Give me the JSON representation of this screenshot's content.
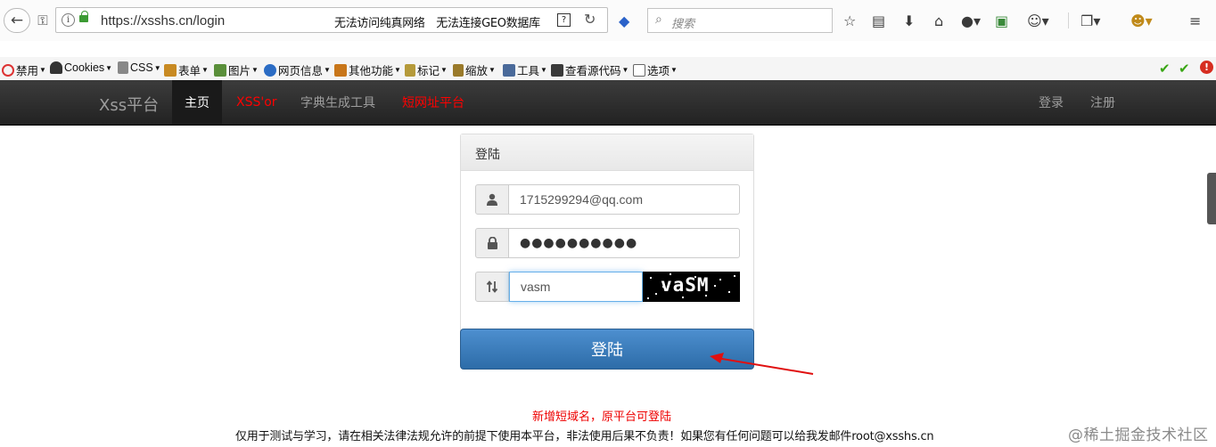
{
  "browser": {
    "url": "https://xsshs.cn/login",
    "status": "无法访问纯真网络　无法连接GEO数据库",
    "reader_glyph": "?",
    "search_placeholder": "搜索"
  },
  "devbar": {
    "items": [
      "禁用",
      "Cookies",
      "CSS",
      "表单",
      "图片",
      "网页信息",
      "其他功能",
      "标记",
      "缩放",
      "工具",
      "查看源代码",
      "选项"
    ],
    "item_colors": [
      "#d33",
      "#333",
      "#555",
      "#c88a22",
      "#5a8f3a",
      "#2b6cc4",
      "#c8761a",
      "#b59a3a",
      "#9a7a2a",
      "#4a6a9a",
      "#3a3a3a",
      "#666"
    ],
    "warning_glyph": "!"
  },
  "navbar": {
    "brand": "Xss平台",
    "items": [
      {
        "label": "主页",
        "state": "active"
      },
      {
        "label": "XSS'or",
        "state": "red"
      },
      {
        "label": "字典生成工具",
        "state": "normal"
      },
      {
        "label": "短网址平台",
        "state": "red"
      }
    ],
    "right": [
      "登录",
      "注册"
    ]
  },
  "login": {
    "heading": "登陆",
    "email_value": "1715299294@qq.com",
    "password_mask": "●●●●●●●●●●",
    "captcha_value": "vasm",
    "captcha_image_text": "vaSM",
    "submit_label": "登陆"
  },
  "footer": {
    "notice": "新增短域名，原平台可登陆",
    "text": "仅用于测试与学习，请在相关法律法规允许的前提下使用本平台，非法使用后果不负责！如果您有任何问题可以给我发邮件root@xsshs.cn"
  },
  "watermark": "@稀土掘金技术社区",
  "colors": {
    "navbar_bg": "#222222",
    "accent_red": "#ff0000",
    "button_blue": "#337ab7",
    "check_green": "#39a614"
  }
}
